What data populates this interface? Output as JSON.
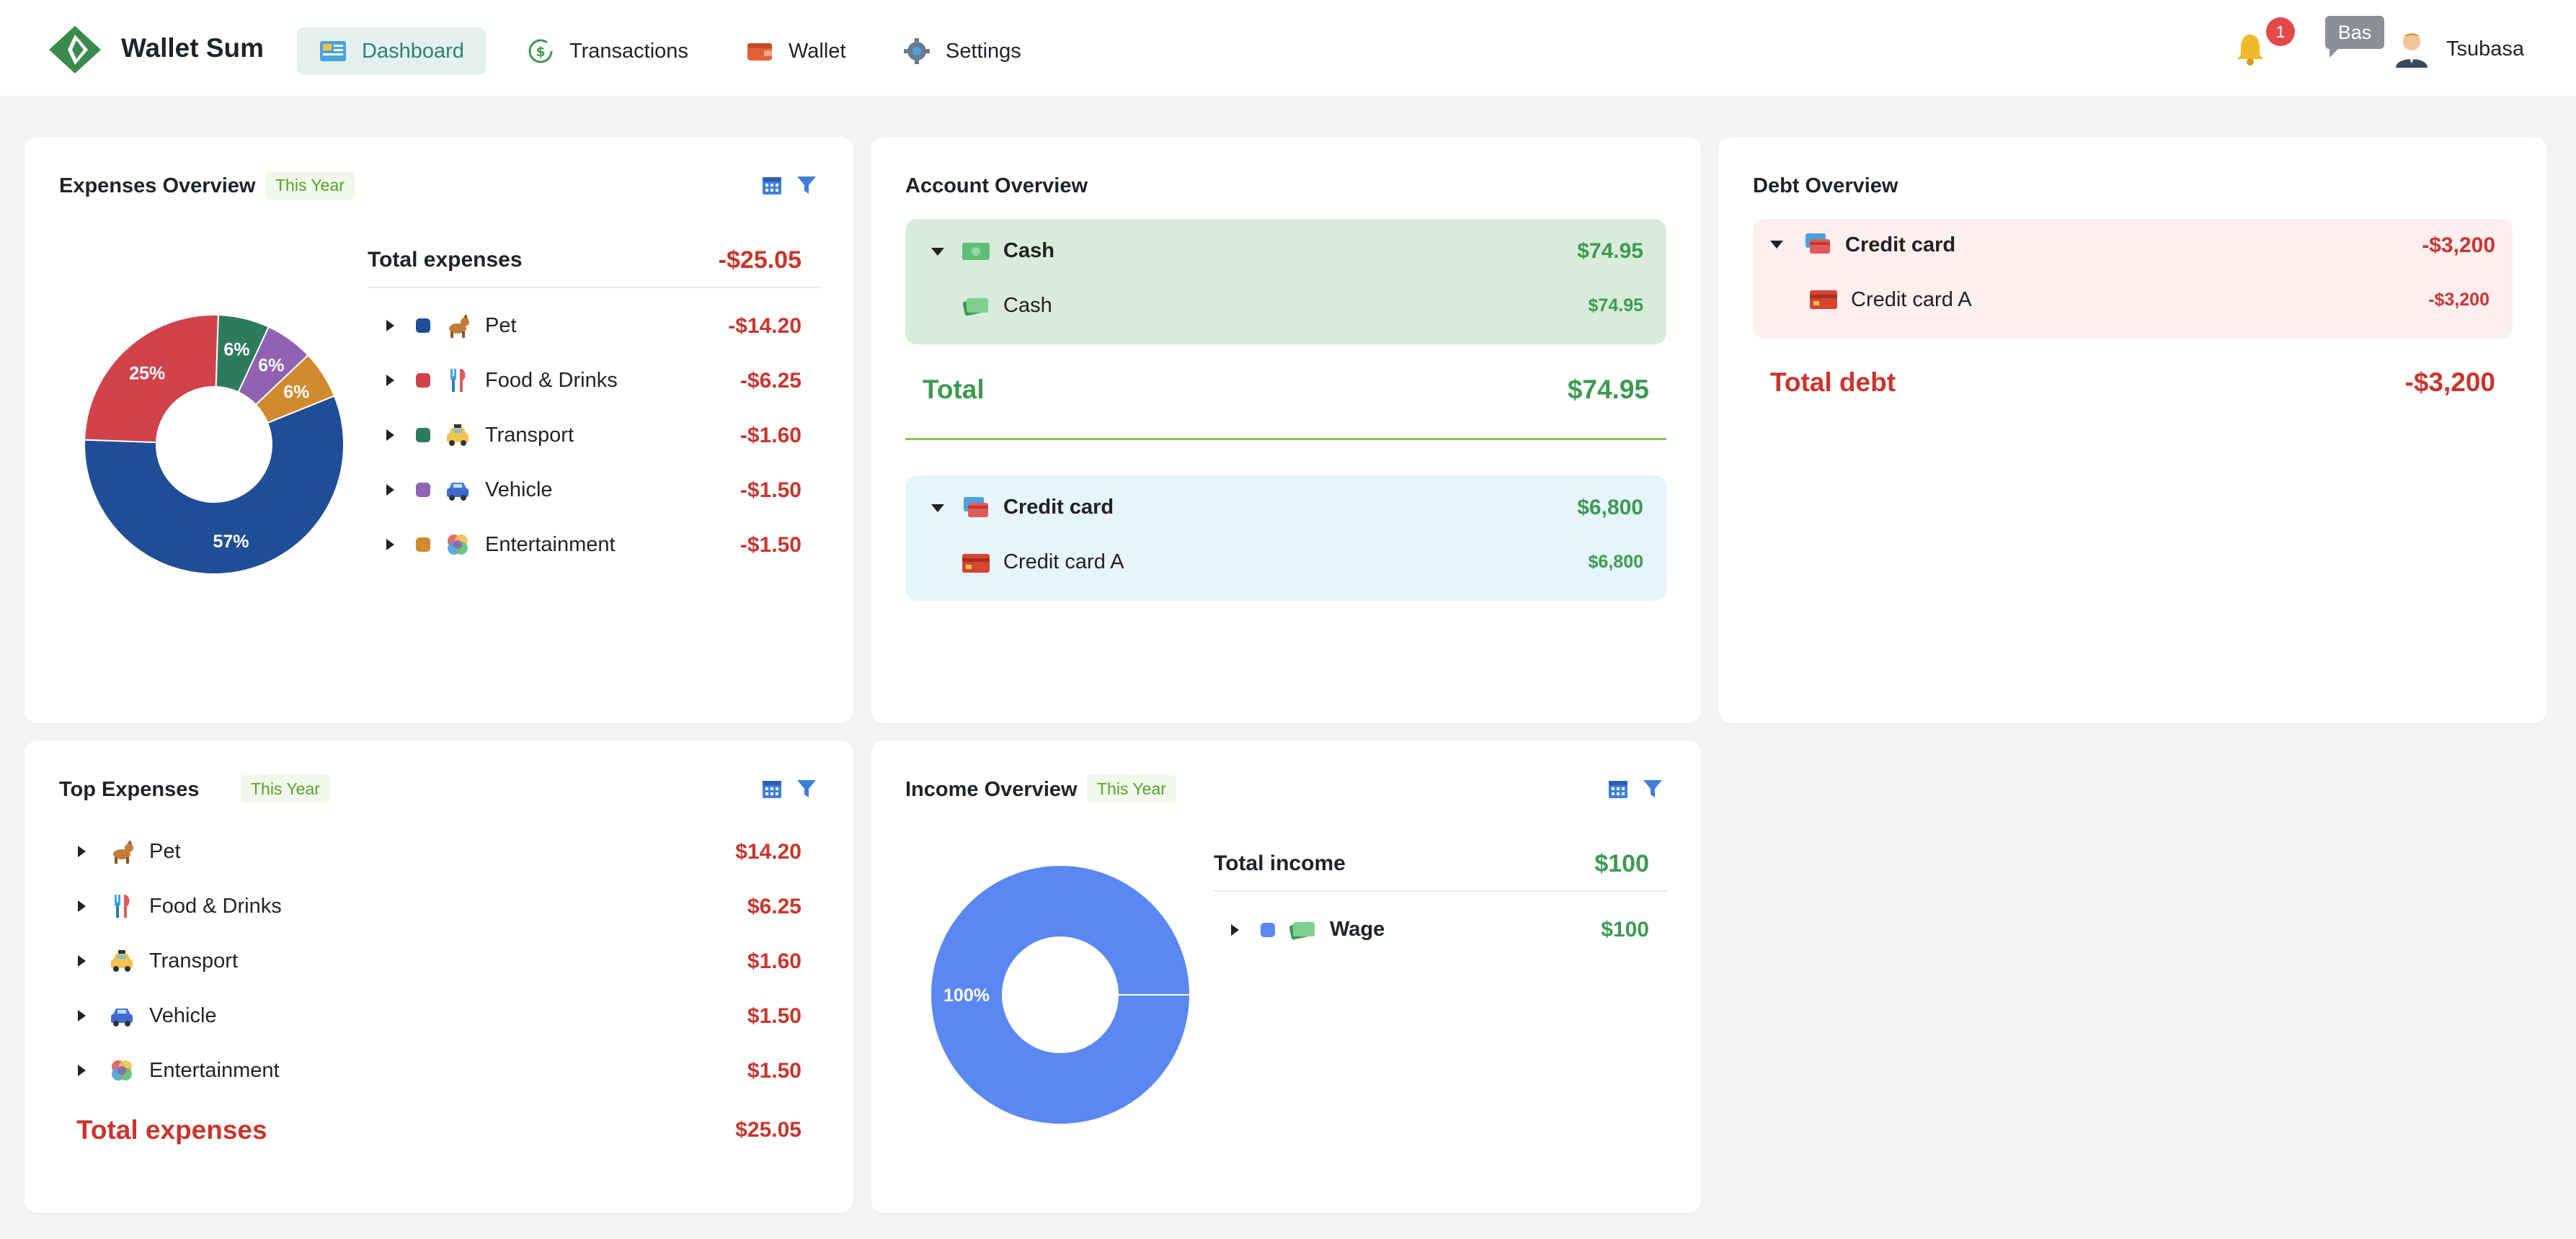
{
  "app": {
    "title": "Wallet Sum"
  },
  "nav": {
    "items": [
      {
        "label": "Dashboard",
        "icon": "dashboard-icon",
        "active": true
      },
      {
        "label": "Transactions",
        "icon": "transactions-icon",
        "active": false
      },
      {
        "label": "Wallet",
        "icon": "wallet-icon",
        "active": false
      },
      {
        "label": "Settings",
        "icon": "gear-icon",
        "active": false
      }
    ],
    "notifications_count": "1",
    "chat_label": "Bas",
    "username": "Tsubasa"
  },
  "expenses_overview": {
    "title": "Expenses Overview",
    "period": "This Year",
    "total_label": "Total expenses",
    "total_value": "-$25.05",
    "categories": [
      {
        "name": "Pet",
        "value": "-$14.20",
        "color": "#1f4e96",
        "icon": "dog-icon"
      },
      {
        "name": "Food & Drinks",
        "value": "-$6.25",
        "color": "#d0434b",
        "icon": "cutlery-icon"
      },
      {
        "name": "Transport",
        "value": "-$1.60",
        "color": "#2e7a5c",
        "icon": "taxi-icon"
      },
      {
        "name": "Vehicle",
        "value": "-$1.50",
        "color": "#9162b2",
        "icon": "car-icon"
      },
      {
        "name": "Entertainment",
        "value": "-$1.50",
        "color": "#d28a2e",
        "icon": "palette-icon"
      }
    ]
  },
  "account_overview": {
    "title": "Account Overview",
    "groups": [
      {
        "name": "Cash",
        "value": "$74.95",
        "accounts": [
          {
            "name": "Cash",
            "value": "$74.95"
          }
        ]
      },
      {
        "name": "Credit card",
        "value": "$6,800",
        "accounts": [
          {
            "name": "Credit card A",
            "value": "$6,800"
          }
        ]
      }
    ],
    "total_label": "Total",
    "total_value": "$74.95"
  },
  "debt_overview": {
    "title": "Debt Overview",
    "group": {
      "name": "Credit card",
      "value": "-$3,200",
      "accounts": [
        {
          "name": "Credit card A",
          "value": "-$3,200"
        }
      ]
    },
    "total_label": "Total debt",
    "total_value": "-$3,200"
  },
  "top_expenses": {
    "title": "Top Expenses",
    "period": "This Year",
    "items": [
      {
        "name": "Pet",
        "value": "$14.20"
      },
      {
        "name": "Food & Drinks",
        "value": "$6.25"
      },
      {
        "name": "Transport",
        "value": "$1.60"
      },
      {
        "name": "Vehicle",
        "value": "$1.50"
      },
      {
        "name": "Entertainment",
        "value": "$1.50"
      }
    ],
    "total_label": "Total expenses",
    "total_value": "$25.05"
  },
  "income_overview": {
    "title": "Income Overview",
    "period": "This Year",
    "total_label": "Total income",
    "total_value": "$100",
    "categories": [
      {
        "name": "Wage",
        "value": "$100",
        "color": "#5b87f0"
      }
    ]
  },
  "chart_data": [
    {
      "type": "pie",
      "categories": [
        "Pet",
        "Food & Drinks",
        "Transport",
        "Vehicle",
        "Entertainment"
      ],
      "values": [
        14.2,
        6.25,
        1.6,
        1.5,
        1.5
      ],
      "labels": [
        "57%",
        "25%",
        "6%",
        "6%",
        "6%"
      ],
      "colors": [
        "#1f4e96",
        "#d0434b",
        "#2e7a5c",
        "#9162b2",
        "#d28a2e"
      ]
    },
    {
      "type": "pie",
      "categories": [
        "Wage"
      ],
      "values": [
        100
      ],
      "labels": [
        "100%"
      ],
      "colors": [
        "#5b87f0"
      ]
    }
  ]
}
